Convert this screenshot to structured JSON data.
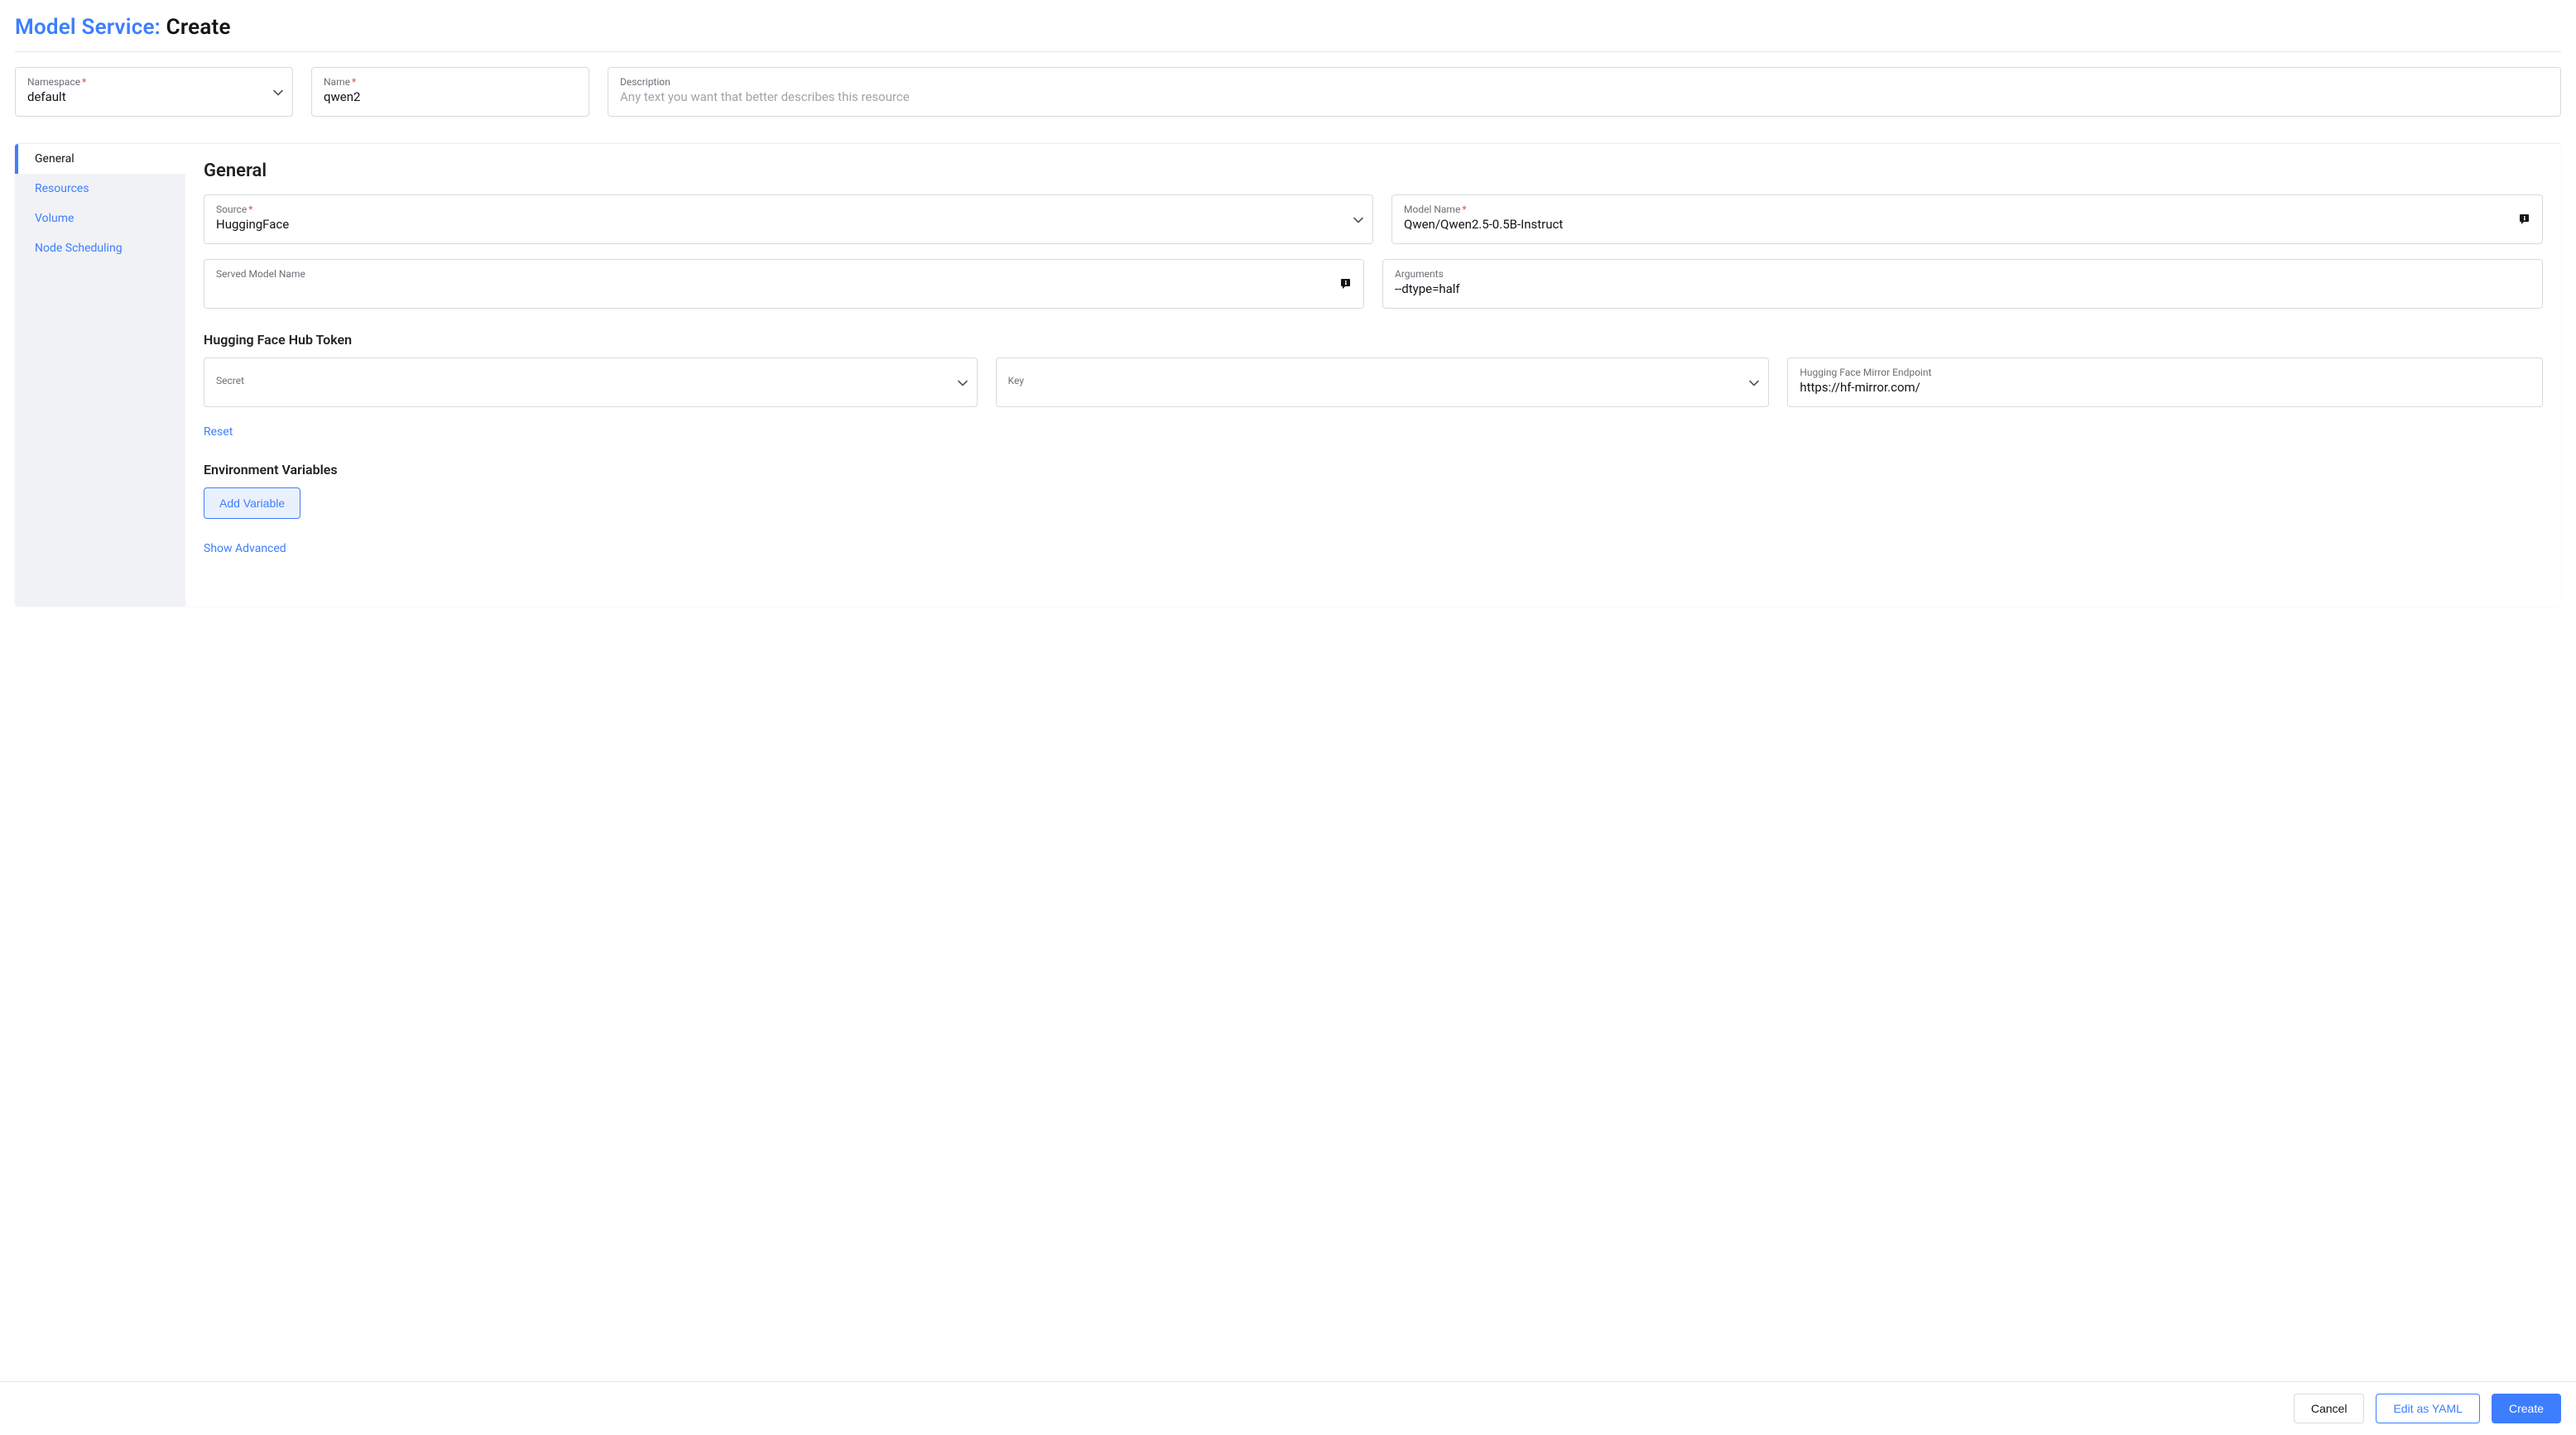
{
  "page": {
    "breadcrumb_prefix": "Model Service:",
    "breadcrumb_current": "Create"
  },
  "top": {
    "namespace": {
      "label": "Namespace",
      "value": "default"
    },
    "name": {
      "label": "Name",
      "value": "qwen2"
    },
    "description": {
      "label": "Description",
      "placeholder": "Any text you want that better describes this resource",
      "value": ""
    }
  },
  "tabs": {
    "general": "General",
    "resources": "Resources",
    "volume": "Volume",
    "node_scheduling": "Node Scheduling"
  },
  "general": {
    "title": "General",
    "source": {
      "label": "Source",
      "value": "HuggingFace"
    },
    "model_name": {
      "label": "Model Name",
      "value": "Qwen/Qwen2.5-0.5B-Instruct"
    },
    "served_model_name": {
      "label": "Served Model Name",
      "value": ""
    },
    "arguments": {
      "label": "Arguments",
      "value": "--dtype=half"
    },
    "hf_token_title": "Hugging Face Hub Token",
    "secret": {
      "label": "Secret",
      "value": ""
    },
    "key": {
      "label": "Key",
      "value": ""
    },
    "hf_mirror": {
      "label": "Hugging Face Mirror Endpoint",
      "value": "https://hf-mirror.com/"
    },
    "reset": "Reset",
    "env_vars_title": "Environment Variables",
    "add_variable": "Add Variable",
    "show_advanced": "Show Advanced"
  },
  "footer": {
    "cancel": "Cancel",
    "edit_yaml": "Edit as YAML",
    "create": "Create"
  }
}
